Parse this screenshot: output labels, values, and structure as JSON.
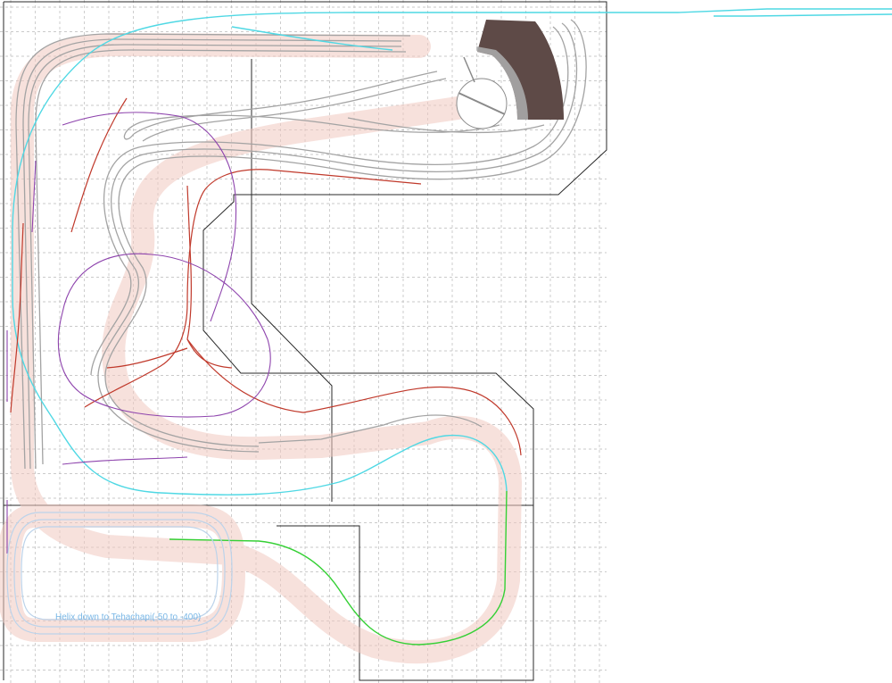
{
  "labels": {
    "helix": "Helix down to Tehachapi(-50 to -400)"
  },
  "colors": {
    "grid": "#b9b9b9",
    "benchwork": "#2a2a2a",
    "roadbed": "#f1c9c1",
    "mainline": "#a3a3a3",
    "teal_line": "#4fd8e4",
    "red_line": "#c0392b",
    "purple_line": "#8e44ad",
    "green_line": "#35d035",
    "helix_blue": "#bcd3ea",
    "turntable_house": "#5e4a47",
    "turntable_stalls": "#a8a8a8",
    "helix_text": "#79b7e6"
  }
}
